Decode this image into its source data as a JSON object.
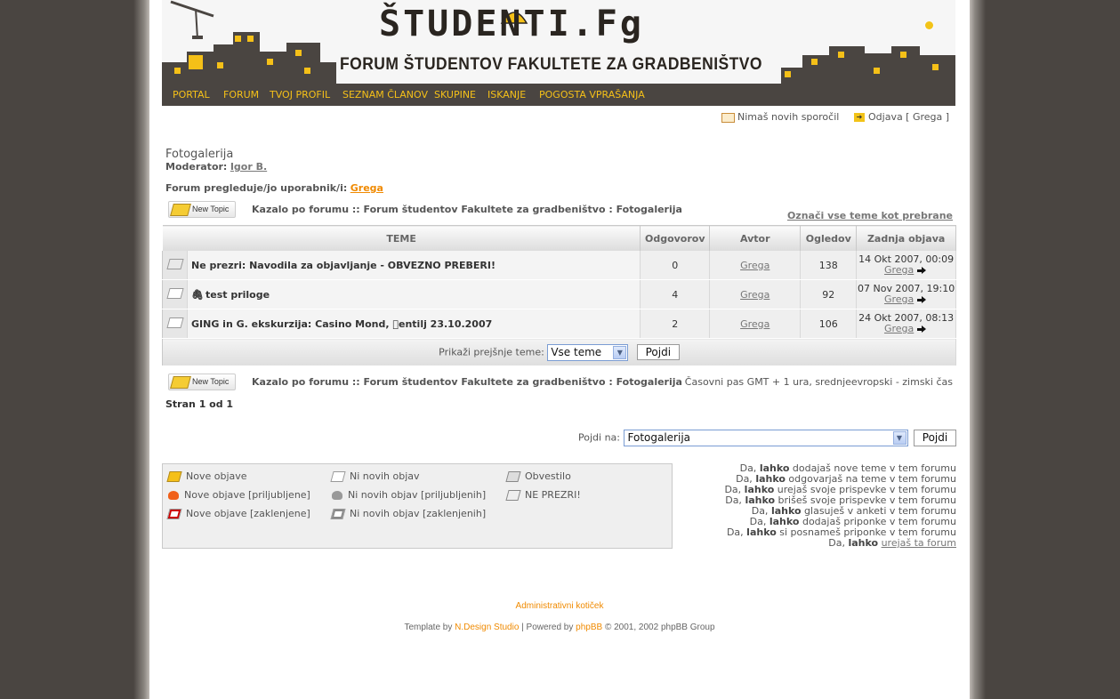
{
  "header": {
    "logo": "ŠTUDENTI.Fg",
    "subtitle": "FORUM ŠTUDENTOV FAKULTETE ZA GRADBENIŠTVO"
  },
  "nav": [
    "PORTAL",
    "FORUM",
    "TVOJ PROFIL",
    "SEZNAM ČLANOV",
    "SKUPINE",
    "ISKANJE",
    "POGOSTA VPRAŠANJA"
  ],
  "userbar": {
    "messages": "Nimaš novih sporočil",
    "logout": "Odjava [ Grega ]"
  },
  "forum": {
    "title": "Fotogalerija",
    "moderator_label": "Moderator:",
    "moderator": "Igor B.",
    "viewing_label": "Forum pregleduje/jo uporabnik/i:",
    "viewing_user": "Grega",
    "new_topic": "New Topic",
    "breadcrumb": "Kazalo po forumu :: Forum študentov Fakultete za gradbeništvo : Fotogalerija",
    "mark_read": "Označi vse teme kot prebrane"
  },
  "table": {
    "headers": [
      "TEME",
      "Odgovorov",
      "Avtor",
      "Ogledov",
      "Zadnja objava"
    ],
    "rows": [
      {
        "title": "Ne prezri: Navodila za objavljanje - OBVEZNO PREBERI!",
        "replies": "0",
        "author": "Grega",
        "views": "138",
        "last_date": "14 Okt 2007, 00:09",
        "last_user": "Grega"
      },
      {
        "title": "test priloge",
        "replies": "4",
        "author": "Grega",
        "views": "92",
        "last_date": "07 Nov 2007, 19:10",
        "last_user": "Grega"
      },
      {
        "title": "GING in G. ekskurzija: Casino Mond, entilj 23.10.2007",
        "replies": "2",
        "author": "Grega",
        "views": "106",
        "last_date": "24 Okt 2007, 08:13",
        "last_user": "Grega"
      }
    ],
    "show_prev_label": "Prikaži prejšnje teme:",
    "show_prev_value": "Vse teme",
    "go": "Pojdi"
  },
  "bottom": {
    "timezone": "Časovni pas GMT + 1 ura, srednjeevropski - zimski čas",
    "page": "Stran 1 od 1",
    "jump_label": "Pojdi na:",
    "jump_value": "Fotogalerija",
    "go": "Pojdi"
  },
  "legend": [
    "Nove objave",
    "Ni novih objav",
    "Obvestilo",
    "Nove objave [priljubljene]",
    "Ni novih objav [priljubljenih]",
    "NE PREZRI!",
    "Nove objave [zaklenjene]",
    "Ni novih objav [zaklenjenih]"
  ],
  "permissions": [
    {
      "pre": "Da, ",
      "b": "lahko",
      "post": " dodajaš nove teme v tem forumu"
    },
    {
      "pre": "Da, ",
      "b": "lahko",
      "post": " odgovarjaš na teme v tem forumu"
    },
    {
      "pre": "Da, ",
      "b": "lahko",
      "post": " urejaš svoje prispevke v tem forumu"
    },
    {
      "pre": "Da, ",
      "b": "lahko",
      "post": " brišeš svoje prispevke v tem forumu"
    },
    {
      "pre": "Da, ",
      "b": "lahko",
      "post": " glasuješ v anketi v tem forumu"
    },
    {
      "pre": "Da, ",
      "b": "lahko",
      "post": " dodajaš priponke v tem forumu"
    },
    {
      "pre": "Da, ",
      "b": "lahko",
      "post": " si posnameš priponke v tem forumu"
    },
    {
      "pre": "Da, ",
      "b": "lahko",
      "post": " ",
      "link": "urejaš ta forum"
    }
  ],
  "footer": {
    "admin": "Administrativni kotiček",
    "template_pre": "Template by ",
    "ndesign": "N.Design Studio",
    "powered": " | Powered by ",
    "phpbb": "phpBB",
    "copy": " © 2001, 2002 phpBB Group"
  },
  "colors": {
    "accent": "#f5c018",
    "dark": "#4a4541",
    "link_orange": "#f08a00"
  }
}
